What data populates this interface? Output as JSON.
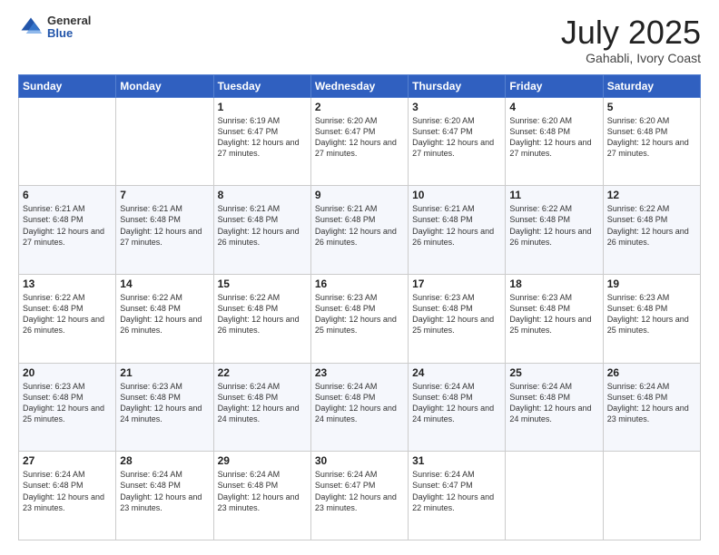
{
  "header": {
    "logo_general": "General",
    "logo_blue": "Blue",
    "month": "July 2025",
    "location": "Gahabli, Ivory Coast"
  },
  "days_of_week": [
    "Sunday",
    "Monday",
    "Tuesday",
    "Wednesday",
    "Thursday",
    "Friday",
    "Saturday"
  ],
  "weeks": [
    [
      {
        "day": "",
        "text": ""
      },
      {
        "day": "",
        "text": ""
      },
      {
        "day": "1",
        "text": "Sunrise: 6:19 AM\nSunset: 6:47 PM\nDaylight: 12 hours and 27 minutes."
      },
      {
        "day": "2",
        "text": "Sunrise: 6:20 AM\nSunset: 6:47 PM\nDaylight: 12 hours and 27 minutes."
      },
      {
        "day": "3",
        "text": "Sunrise: 6:20 AM\nSunset: 6:47 PM\nDaylight: 12 hours and 27 minutes."
      },
      {
        "day": "4",
        "text": "Sunrise: 6:20 AM\nSunset: 6:48 PM\nDaylight: 12 hours and 27 minutes."
      },
      {
        "day": "5",
        "text": "Sunrise: 6:20 AM\nSunset: 6:48 PM\nDaylight: 12 hours and 27 minutes."
      }
    ],
    [
      {
        "day": "6",
        "text": "Sunrise: 6:21 AM\nSunset: 6:48 PM\nDaylight: 12 hours and 27 minutes."
      },
      {
        "day": "7",
        "text": "Sunrise: 6:21 AM\nSunset: 6:48 PM\nDaylight: 12 hours and 27 minutes."
      },
      {
        "day": "8",
        "text": "Sunrise: 6:21 AM\nSunset: 6:48 PM\nDaylight: 12 hours and 26 minutes."
      },
      {
        "day": "9",
        "text": "Sunrise: 6:21 AM\nSunset: 6:48 PM\nDaylight: 12 hours and 26 minutes."
      },
      {
        "day": "10",
        "text": "Sunrise: 6:21 AM\nSunset: 6:48 PM\nDaylight: 12 hours and 26 minutes."
      },
      {
        "day": "11",
        "text": "Sunrise: 6:22 AM\nSunset: 6:48 PM\nDaylight: 12 hours and 26 minutes."
      },
      {
        "day": "12",
        "text": "Sunrise: 6:22 AM\nSunset: 6:48 PM\nDaylight: 12 hours and 26 minutes."
      }
    ],
    [
      {
        "day": "13",
        "text": "Sunrise: 6:22 AM\nSunset: 6:48 PM\nDaylight: 12 hours and 26 minutes."
      },
      {
        "day": "14",
        "text": "Sunrise: 6:22 AM\nSunset: 6:48 PM\nDaylight: 12 hours and 26 minutes."
      },
      {
        "day": "15",
        "text": "Sunrise: 6:22 AM\nSunset: 6:48 PM\nDaylight: 12 hours and 26 minutes."
      },
      {
        "day": "16",
        "text": "Sunrise: 6:23 AM\nSunset: 6:48 PM\nDaylight: 12 hours and 25 minutes."
      },
      {
        "day": "17",
        "text": "Sunrise: 6:23 AM\nSunset: 6:48 PM\nDaylight: 12 hours and 25 minutes."
      },
      {
        "day": "18",
        "text": "Sunrise: 6:23 AM\nSunset: 6:48 PM\nDaylight: 12 hours and 25 minutes."
      },
      {
        "day": "19",
        "text": "Sunrise: 6:23 AM\nSunset: 6:48 PM\nDaylight: 12 hours and 25 minutes."
      }
    ],
    [
      {
        "day": "20",
        "text": "Sunrise: 6:23 AM\nSunset: 6:48 PM\nDaylight: 12 hours and 25 minutes."
      },
      {
        "day": "21",
        "text": "Sunrise: 6:23 AM\nSunset: 6:48 PM\nDaylight: 12 hours and 24 minutes."
      },
      {
        "day": "22",
        "text": "Sunrise: 6:24 AM\nSunset: 6:48 PM\nDaylight: 12 hours and 24 minutes."
      },
      {
        "day": "23",
        "text": "Sunrise: 6:24 AM\nSunset: 6:48 PM\nDaylight: 12 hours and 24 minutes."
      },
      {
        "day": "24",
        "text": "Sunrise: 6:24 AM\nSunset: 6:48 PM\nDaylight: 12 hours and 24 minutes."
      },
      {
        "day": "25",
        "text": "Sunrise: 6:24 AM\nSunset: 6:48 PM\nDaylight: 12 hours and 24 minutes."
      },
      {
        "day": "26",
        "text": "Sunrise: 6:24 AM\nSunset: 6:48 PM\nDaylight: 12 hours and 23 minutes."
      }
    ],
    [
      {
        "day": "27",
        "text": "Sunrise: 6:24 AM\nSunset: 6:48 PM\nDaylight: 12 hours and 23 minutes."
      },
      {
        "day": "28",
        "text": "Sunrise: 6:24 AM\nSunset: 6:48 PM\nDaylight: 12 hours and 23 minutes."
      },
      {
        "day": "29",
        "text": "Sunrise: 6:24 AM\nSunset: 6:48 PM\nDaylight: 12 hours and 23 minutes."
      },
      {
        "day": "30",
        "text": "Sunrise: 6:24 AM\nSunset: 6:47 PM\nDaylight: 12 hours and 23 minutes."
      },
      {
        "day": "31",
        "text": "Sunrise: 6:24 AM\nSunset: 6:47 PM\nDaylight: 12 hours and 22 minutes."
      },
      {
        "day": "",
        "text": ""
      },
      {
        "day": "",
        "text": ""
      }
    ]
  ]
}
